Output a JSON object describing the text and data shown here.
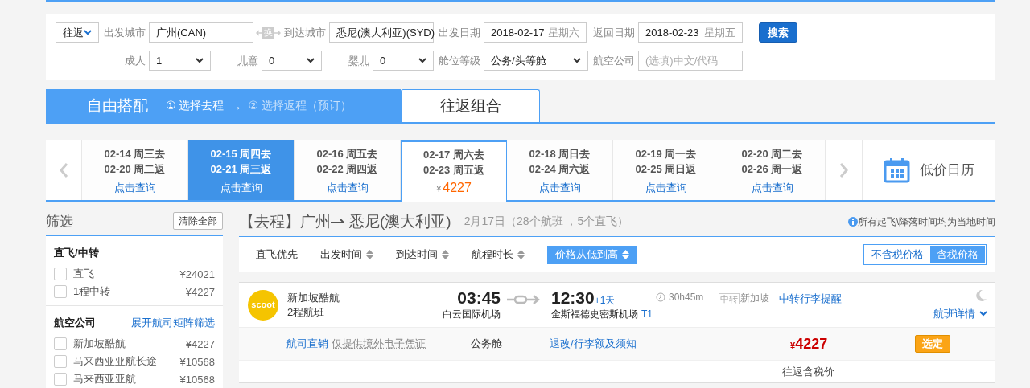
{
  "search": {
    "trip_type": "往返",
    "from": {
      "label": "出发城市",
      "value": "广州(CAN)"
    },
    "swap": "换",
    "to": {
      "label": "到达城市",
      "value": "悉尼(澳大利亚)(SYD)"
    },
    "depart": {
      "label": "出发日期",
      "value": "2018-02-17",
      "weekday": "星期六"
    },
    "return": {
      "label": "返回日期",
      "value": "2018-02-23",
      "weekday": "星期五"
    },
    "search_button": "搜索",
    "passengers": [
      {
        "label": "成人",
        "value": "1"
      },
      {
        "label": "儿童",
        "value": "0"
      },
      {
        "label": "婴儿",
        "value": "0"
      }
    ],
    "cabin": {
      "label": "舱位等级",
      "value": "公务/头等舱"
    },
    "airline": {
      "label": "航空公司",
      "placeholder": "(选填)中文/代码"
    }
  },
  "mode_tabs": [
    {
      "label": "自由搭配",
      "selected": true
    },
    {
      "label": "往返组合",
      "selected": false
    }
  ],
  "steps": [
    {
      "number": "①",
      "label": "选择去程",
      "active": true
    },
    {
      "number": "②",
      "label": "选择返程（预订）",
      "active": false
    }
  ],
  "step_arrow": "→",
  "date_cells": [
    {
      "depart": "02-14 周三去",
      "return": "02-20 周二返",
      "action": "点击查询",
      "selected": false,
      "highlighted": false
    },
    {
      "depart": "02-15 周四去",
      "return": "02-21 周三返",
      "action": "点击查询",
      "selected": false,
      "highlighted": true
    },
    {
      "depart": "02-16 周五去",
      "return": "02-22 周四返",
      "action": "点击查询",
      "selected": false,
      "highlighted": false
    },
    {
      "depart": "02-17 周六去",
      "return": "02-23 周五返",
      "price": {
        "currency": "¥",
        "amount": "4227"
      },
      "selected": true,
      "highlighted": false
    },
    {
      "depart": "02-18 周日去",
      "return": "02-24 周六返",
      "action": "点击查询",
      "selected": false,
      "highlighted": false
    },
    {
      "depart": "02-19 周一去",
      "return": "02-25 周日返",
      "action": "点击查询",
      "selected": false,
      "highlighted": false
    },
    {
      "depart": "02-20 周二去",
      "return": "02-26 周一返",
      "action": "点击查询",
      "selected": false,
      "highlighted": false
    }
  ],
  "calendar_link": "低价日历",
  "filter": {
    "title": "筛选",
    "clear": "清除全部",
    "groups": [
      {
        "title": "直飞/中转",
        "options": [
          {
            "label": "直飞",
            "price": "¥24021",
            "checked": false
          },
          {
            "label": "1程中转",
            "price": "¥4227",
            "checked": false
          }
        ]
      },
      {
        "title": "航空公司",
        "link": "展开航司矩阵筛选",
        "options": [
          {
            "label": "新加坡酷航",
            "price": "¥4227",
            "checked": false
          },
          {
            "label": "马来西亚亚航长途",
            "price": "¥10568",
            "checked": false
          },
          {
            "label": "马来西亚亚航",
            "price": "¥10568",
            "checked": false
          }
        ]
      }
    ]
  },
  "results": {
    "heading": {
      "tag": "【去程】",
      "from": "广州",
      "to": "悉尼(澳大利亚)",
      "summary": "2月17日（28个航班 ，5个直飞）"
    },
    "note": "所有起飞\\降落时间均为当地时间",
    "sort_options": [
      {
        "label": "直飞优先",
        "sortable": false,
        "selected": false
      },
      {
        "label": "出发时间",
        "sortable": true,
        "selected": false
      },
      {
        "label": "到达时间",
        "sortable": true,
        "selected": false
      },
      {
        "label": "航程时长",
        "sortable": true,
        "selected": false
      },
      {
        "label": "价格从低到高",
        "sortable": true,
        "selected": true
      }
    ],
    "price_toggle": [
      {
        "label": "不含税价格",
        "selected": false
      },
      {
        "label": "含税价格",
        "selected": true
      }
    ],
    "flights": [
      {
        "logo_text": "scoot",
        "airline": "新加坡酷航",
        "legs": "2程航班",
        "depart_time": "03:45",
        "depart_airport": "白云国际机场",
        "arrive_time": "12:30",
        "day_offset": "+1天",
        "arrive_airport": "金斯福德史密斯机场",
        "terminal": "T1",
        "duration": "30h45m",
        "transfer_tag": "中转",
        "transfer_city": "新加坡",
        "transfer_link": "中转行李提醒",
        "overnight": true,
        "details_link": "航班详情",
        "fare": {
          "seller": "航司直销",
          "ticket_note": "仅提供境外电子凭证",
          "cabin": "公务舱",
          "rules_link": "退改/行李额及须知",
          "currency": "¥",
          "amount": "4227",
          "select_button": "选定",
          "price_note": "往返含税价"
        }
      }
    ]
  }
}
